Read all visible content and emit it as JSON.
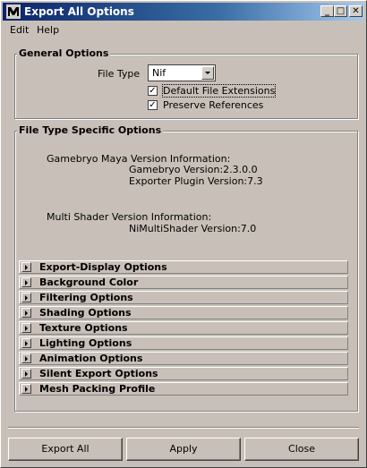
{
  "window": {
    "title": "Export All Options"
  },
  "menu": [
    "Edit",
    "Help"
  ],
  "general": {
    "title": "General Options",
    "file_type_label": "File Type",
    "file_type_value": "Nif",
    "checkboxes": [
      {
        "label": "Default File Extensions",
        "checked": true
      },
      {
        "label": "Preserve References",
        "checked": true
      }
    ]
  },
  "specific": {
    "title": "File Type Specific Options",
    "gamebryo_heading": "Gamebryo Maya Version Information:",
    "gamebryo_version": "Gamebryo Version:2.3.0.0",
    "exporter_version": "Exporter Plugin Version:7.3",
    "shader_heading": "Multi Shader Version Information:",
    "shader_version": "NiMultiShader Version:7.0",
    "sections": [
      "Export-Display Options",
      "Background Color",
      "Filtering Options",
      "Shading Options",
      "Texture Options",
      "Lighting Options",
      "Animation Options",
      "Silent Export Options",
      "Mesh Packing Profile"
    ]
  },
  "buttons": {
    "export_all": "Export All",
    "apply": "Apply",
    "close": "Close"
  }
}
